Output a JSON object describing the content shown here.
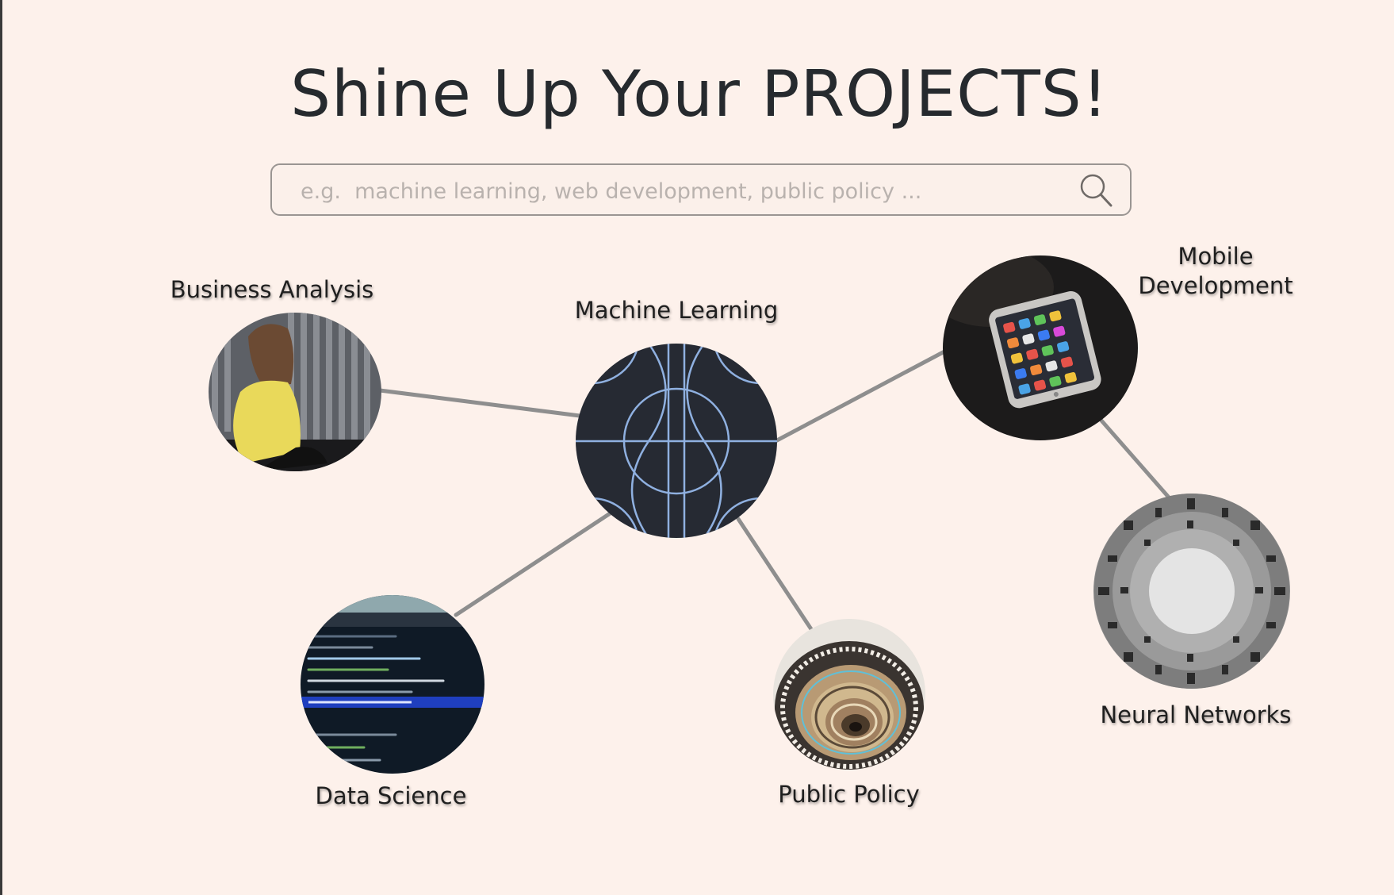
{
  "header": {
    "title": "Shine Up Your PROJECTS!"
  },
  "search": {
    "placeholder": "e.g.  machine learning, web development, public policy ...",
    "value": "",
    "icon": "search-icon"
  },
  "colors": {
    "background": "#fdf1eb",
    "connector": "#8e8e8e",
    "hub": "#262a33",
    "hub_lines": "#8fb0e0"
  },
  "topics": {
    "business_analysis": {
      "label": "Business  Analysis",
      "image": "woman in yellow blouse"
    },
    "machine_learning": {
      "label": "Machine Learning",
      "image": "blue line pattern on dark circle"
    },
    "mobile_development": {
      "label_line1": "Mobile",
      "label_line2": "Development",
      "image": "smartphone with app icons"
    },
    "data_science": {
      "label": "Data Science",
      "image": "code on a screen"
    },
    "public_policy": {
      "label": "Public  Policy",
      "image": "spiral staircase"
    },
    "neural_networks": {
      "label": "Neural Networks",
      "image": "circular building looking up"
    }
  }
}
